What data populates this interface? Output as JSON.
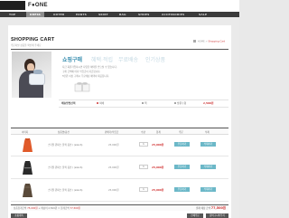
{
  "header": {
    "logo": "F●ONE",
    "nav": [
      "TOP",
      "DRESS",
      "OUTER",
      "PANTS",
      "SKIRT",
      "BAG",
      "SHOES",
      "ACCESSORIES",
      "SALE"
    ],
    "active_nav": "DRESS"
  },
  "page": {
    "title": "SHOPPING CART",
    "subtitle": "주문하실 상품을 확인해 주세요",
    "breadcrumb_prefix": "HOME >",
    "breadcrumb_current": "Shopping Cart"
  },
  "benefits": {
    "tabs": [
      "쇼핑구매",
      "혜택·적립",
      "무료배송",
      "인기상품"
    ],
    "desc": [
      "지금 회원가입하시면 다양한 혜택을 받으실 수 있습니다.",
      "구매 금액에 따라 적립금이 지급됩니다.",
      "5만원 이상 구매시 무료배송 혜택이 제공됩니다."
    ]
  },
  "shipping": {
    "label": "배송방법선택",
    "options": [
      "택배",
      "퀵",
      "방문수령"
    ],
    "selected": 0,
    "price": "2,500원"
  },
  "table": {
    "headers": [
      "이미지",
      "상품명/옵션",
      "판매가/적립금",
      "수량",
      "합계",
      "주문",
      "삭제"
    ],
    "rows": [
      {
        "name": "스타일 원피스 블랙 옵션 / (size:S)",
        "price": "25,000원",
        "qty": "1",
        "total": "25,000원",
        "order": "주문하기",
        "delete": "삭제하기",
        "color": "#e05a2a"
      },
      {
        "name": "스타일 원피스 블랙 옵션 / (size:S)",
        "price": "25,000원",
        "qty": "1",
        "total": "25,000원",
        "order": "주문하기",
        "delete": "삭제하기",
        "color": "#2b2b2b"
      },
      {
        "name": "스타일 원피스 블랙 옵션 / (size:S)",
        "price": "25,000원",
        "qty": "1",
        "total": "25,000원",
        "order": "주문하기",
        "delete": "삭제하기",
        "color": "#5a4a3a"
      }
    ]
  },
  "summary": {
    "left_prefix": "상품합계금액",
    "left_amount": "75,000원",
    "left_suffix": "+ 배송비 2,500원 = 합계금액",
    "left_total": "77,500원",
    "right_label": "결제 예정 금액",
    "right_total": "77,500원"
  },
  "actions": [
    "쇼핑계속",
    "전체주문",
    "장바구니비우기"
  ]
}
